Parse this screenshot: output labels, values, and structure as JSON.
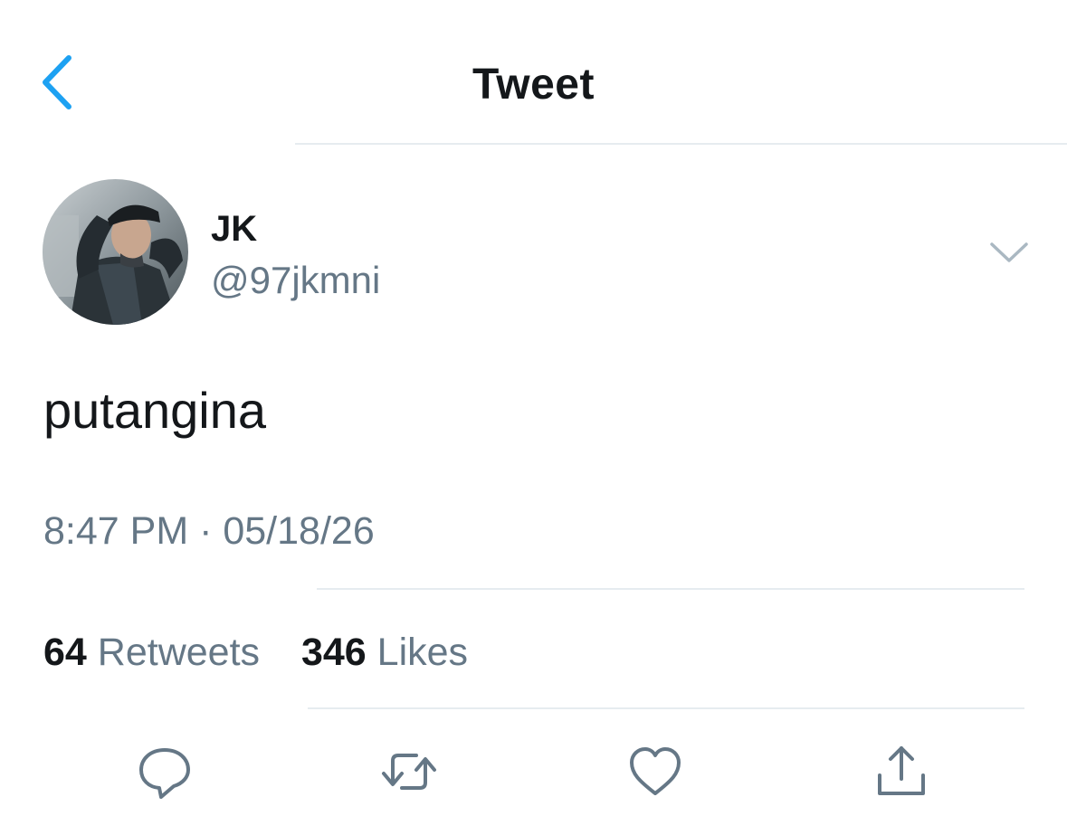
{
  "header": {
    "title": "Tweet",
    "back_icon": "chevron-left-icon"
  },
  "author": {
    "display_name": "JK",
    "handle": "@97jkmni",
    "avatar": "avatar-photo"
  },
  "tweet": {
    "text": "putangina",
    "timestamp": "8:47 PM · 05/18/26"
  },
  "stats": {
    "retweets_count": "64",
    "retweets_label": "Retweets",
    "likes_count": "346",
    "likes_label": "Likes"
  },
  "actions": [
    {
      "icon": "reply-icon"
    },
    {
      "icon": "retweet-icon"
    },
    {
      "icon": "heart-icon"
    },
    {
      "icon": "share-icon"
    }
  ],
  "colors": {
    "accent": "#1da1f2",
    "text_primary": "#14171a",
    "text_secondary": "#657786",
    "divider": "#e6ecf0"
  }
}
